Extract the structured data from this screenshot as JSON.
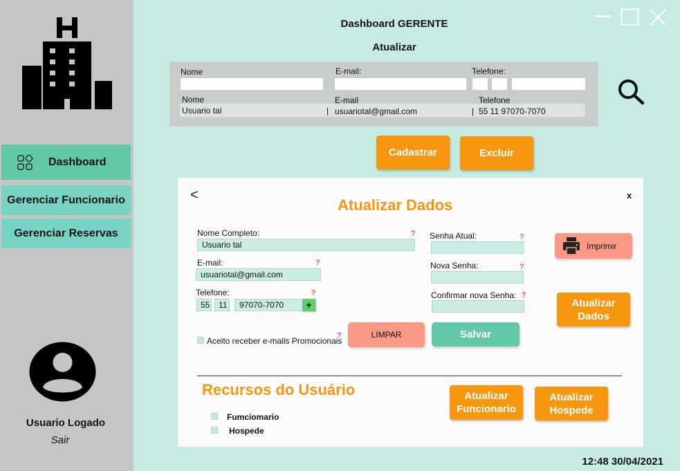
{
  "sidebar": {
    "logo_icon": "hotel-building-icon",
    "items": [
      {
        "label": "Dashboard",
        "icon": "grid-apps-icon"
      },
      {
        "label": "Gerenciar Funcionario"
      },
      {
        "label": "Gerenciar Reservas"
      }
    ],
    "user": {
      "name": "Usuario Logado",
      "action": "Sair",
      "icon": "user-avatar-icon"
    }
  },
  "header": {
    "title": "Dashboard GERENTE",
    "subtitle": "Atualizar"
  },
  "search": {
    "labels": {
      "name": "Nome",
      "email": "E-mail:",
      "phone": "Telefone:"
    },
    "result_headers": {
      "name": "Nome",
      "email": "E-mail",
      "phone": "Telefone"
    },
    "result": {
      "name": "Usuario tal",
      "email": "usuariotal@gmail.com",
      "phone": "55 11 97070-7070"
    }
  },
  "actions": {
    "register": "Cadastrar",
    "delete": "Excluir"
  },
  "modal": {
    "title": "Atualizar Dados",
    "close": "x",
    "back": "<",
    "fields": {
      "full_name": {
        "label": "Nome Completo:",
        "value": "Usuario tal"
      },
      "email": {
        "label": "E-mail:",
        "value": "usuariotal@gmail.com"
      },
      "phone": {
        "label": "Telefone:",
        "ddi": "55",
        "ddd": "11",
        "number": "97070-7070",
        "add": "+"
      },
      "current_password": {
        "label": "Senha Atual:"
      },
      "new_password": {
        "label": "Nova Senha:"
      },
      "confirm_password": {
        "label": "Confirmar nova Senha:"
      }
    },
    "help": "?",
    "promo_checkbox": "Aceito receber e-mails Promocionais",
    "buttons": {
      "clear": "LIMPAR",
      "save": "Salvar",
      "print": "Imprimir",
      "update": "Atualizar Dados",
      "update_employee": "Atualizar Funcionario",
      "update_guest": "Atualizar Hospede"
    },
    "resources": {
      "title": "Recursos do  Usuário",
      "items": [
        "Fumciomario",
        "Hospede"
      ]
    }
  },
  "status": {
    "time": "12:48",
    "date": "30/04/2021"
  },
  "colors": {
    "accent": "#f7960f",
    "teal": "#63c8a8",
    "sidebar": "#c5c5c5",
    "background": "#c6ebe3"
  }
}
